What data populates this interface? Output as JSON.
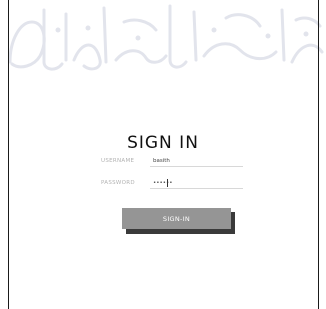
{
  "login": {
    "title": "SIGN IN",
    "username_label": "USERNAME",
    "username_value": "basith",
    "password_label": "PASSWORD",
    "password_value": "••••••",
    "submit_label": "SIGN-IN"
  },
  "colors": {
    "button_bg": "#959595",
    "button_shadow": "#3a3a3a",
    "label_text": "#b2b2b2",
    "watermark": "#e4e6ee",
    "border": "#1a1a1a"
  }
}
